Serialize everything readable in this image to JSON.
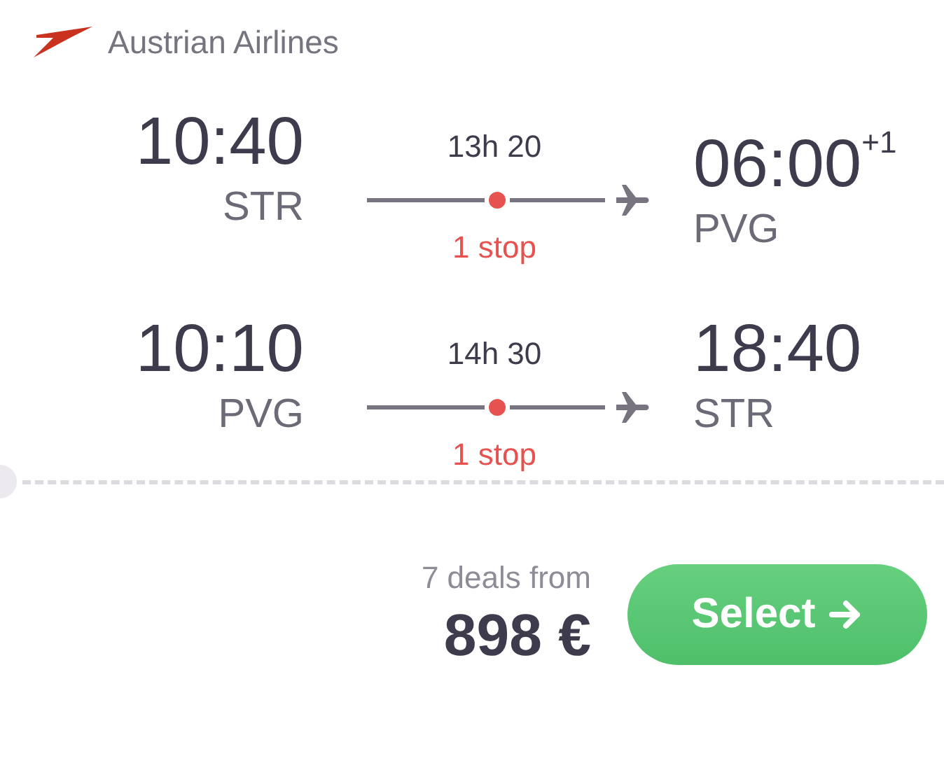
{
  "airline": {
    "name": "Austrian Airlines"
  },
  "legs": [
    {
      "departure_time": "10:40",
      "departure_airport": "STR",
      "duration": "13h 20",
      "stops": "1 stop",
      "arrival_time": "06:00$^{+1}$",
      "arrival_airport": "PVG"
    },
    {
      "departure_time": "10:10",
      "departure_airport": "PVG",
      "duration": "14h 30",
      "stops": "1 stop",
      "arrival_time": "18:40",
      "arrival_airport": "STR"
    }
  ],
  "price": {
    "deals": "7 deals from",
    "amount": "898 €"
  },
  "select_button": {
    "label": "Select"
  }
}
